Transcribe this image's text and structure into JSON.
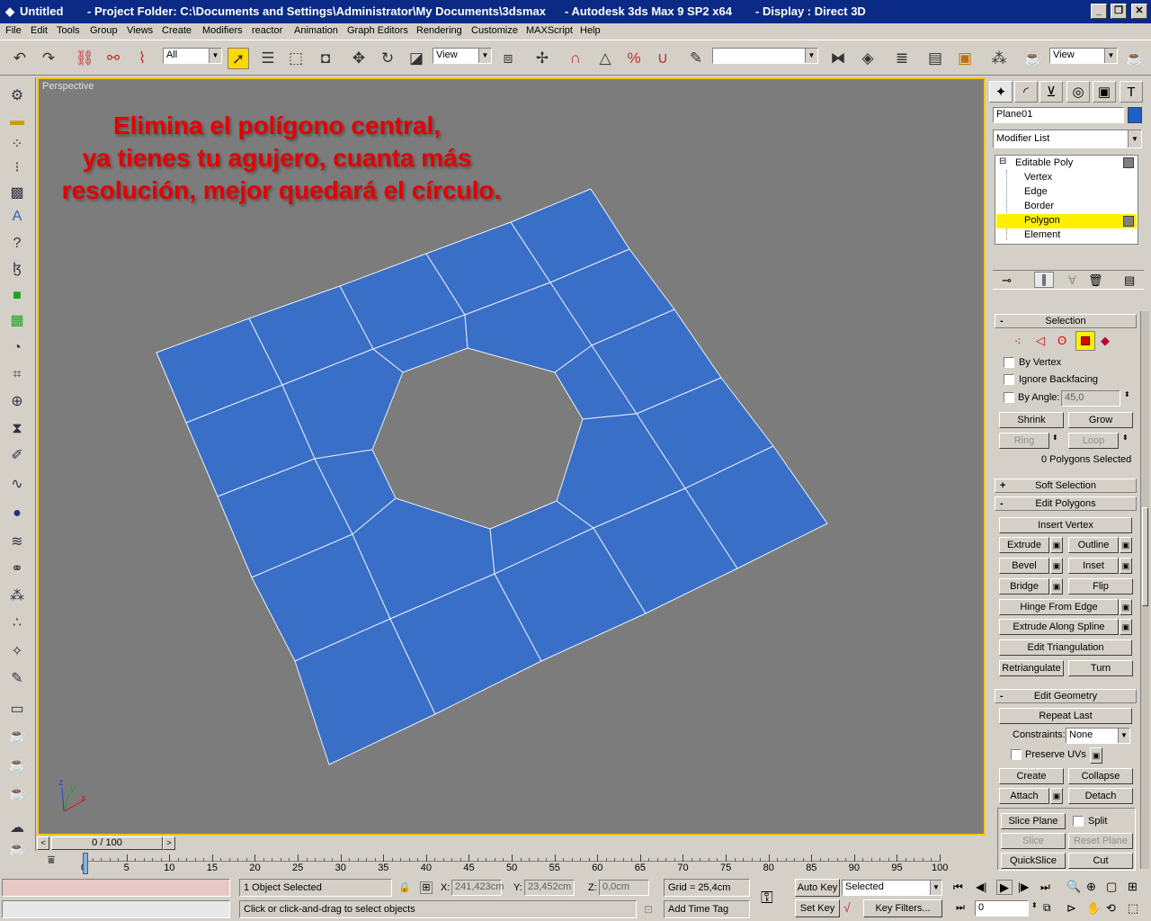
{
  "titlebar": {
    "app": "Untitled",
    "project": "- Project Folder: C:\\Documents and Settings\\Administrator\\My Documents\\3dsmax",
    "product": "- Autodesk 3ds Max 9 SP2 x64",
    "display": "- Display : Direct 3D"
  },
  "menu": [
    "File",
    "Edit",
    "Tools",
    "Group",
    "Views",
    "Create",
    "Modifiers",
    "reactor",
    "Animation",
    "Graph Editors",
    "Rendering",
    "Customize",
    "MAXScript",
    "Help"
  ],
  "toolbar": {
    "selection_filter": "All",
    "ref_coord": "View",
    "named_selection": "",
    "render_view": "View"
  },
  "viewport": {
    "label": "Perspective",
    "overlay_lines": [
      "Elimina el polígono central,",
      "ya tienes tu agujero, cuanta más",
      "resolución, mejor quedará el círculo."
    ],
    "mesh_color": "#3a6fc7",
    "axis_labels": {
      "z": "z",
      "y": "y",
      "x": "x"
    }
  },
  "command_panel": {
    "object_name": "Plane01",
    "object_color": "#1c5fc8",
    "modifier_list": "Modifier List",
    "stack": {
      "root": "Editable Poly",
      "subs": [
        "Vertex",
        "Edge",
        "Border",
        "Polygon",
        "Element"
      ],
      "selected": "Polygon"
    },
    "selection": {
      "title": "Selection",
      "by_vertex": "By Vertex",
      "ignore_backfacing": "Ignore Backfacing",
      "by_angle": "By Angle:",
      "angle_value": "45,0",
      "shrink": "Shrink",
      "grow": "Grow",
      "ring": "Ring",
      "loop": "Loop",
      "status": "0 Polygons Selected"
    },
    "soft_selection": "Soft Selection",
    "edit_polygons": {
      "title": "Edit Polygons",
      "insert_vertex": "Insert Vertex",
      "extrude": "Extrude",
      "outline": "Outline",
      "bevel": "Bevel",
      "inset": "Inset",
      "bridge": "Bridge",
      "flip": "Flip",
      "hinge": "Hinge From Edge",
      "extrude_spline": "Extrude Along Spline",
      "edit_tri": "Edit Triangulation",
      "retri": "Retriangulate",
      "turn": "Turn"
    },
    "edit_geometry": {
      "title": "Edit Geometry",
      "repeat_last": "Repeat Last",
      "constraints": "Constraints:",
      "constraints_value": "None",
      "preserve_uvs": "Preserve UVs",
      "create": "Create",
      "collapse": "Collapse",
      "attach": "Attach",
      "detach": "Detach",
      "slice_plane": "Slice Plane",
      "split": "Split",
      "slice": "Slice",
      "reset_plane": "Reset Plane",
      "quickslice": "QuickSlice",
      "cut": "Cut"
    }
  },
  "timeline": {
    "frame": "0 / 100",
    "ticks": [
      "0",
      "5",
      "10",
      "15",
      "20",
      "25",
      "30",
      "35",
      "40",
      "45",
      "50",
      "55",
      "60",
      "65",
      "70",
      "75",
      "80",
      "85",
      "90",
      "95",
      "100"
    ]
  },
  "status": {
    "selected": "1 Object Selected",
    "prompt": "Click or click-and-drag to select objects",
    "x_label": "X:",
    "x": "241,423cm",
    "y_label": "Y:",
    "y": "23,452cm",
    "z_label": "Z:",
    "z": "0,0cm",
    "grid": "Grid = 25,4cm",
    "add_time_tag": "Add Time Tag",
    "auto_key": "Auto Key",
    "set_key": "Set Key",
    "key_mode": "Selected",
    "key_filters": "Key Filters...",
    "current_frame": "0"
  }
}
